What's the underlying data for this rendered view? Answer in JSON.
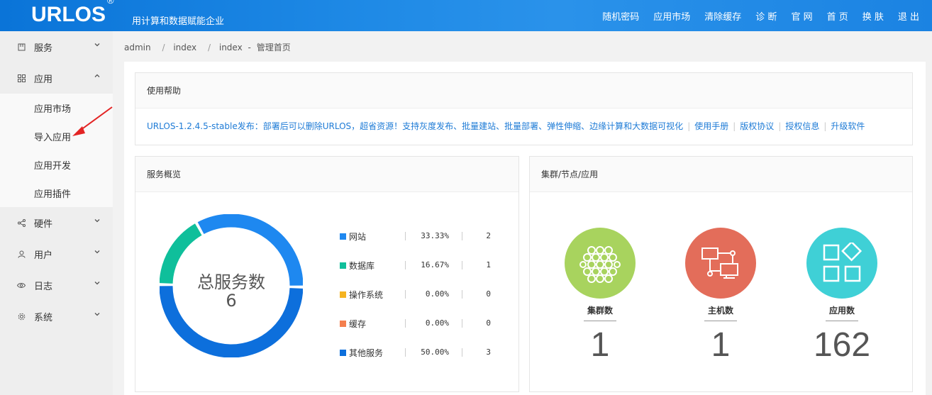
{
  "header": {
    "logo": "URLOS",
    "logo_mark": "®",
    "slogan": "用计算和数据赋能企业",
    "nav": [
      "随机密码",
      "应用市场",
      "清除缓存",
      "诊 断",
      "官 网",
      "首 页",
      "换 肤",
      "退 出"
    ]
  },
  "sidebar": {
    "items": [
      {
        "label": "服务",
        "icon": "service-icon",
        "expanded": false
      },
      {
        "label": "应用",
        "icon": "apps-grid-icon",
        "expanded": true,
        "children": [
          "应用市场",
          "导入应用",
          "应用开发",
          "应用插件"
        ]
      },
      {
        "label": "硬件",
        "icon": "share-nodes-icon",
        "expanded": false
      },
      {
        "label": "用户",
        "icon": "user-icon",
        "expanded": false
      },
      {
        "label": "日志",
        "icon": "eye-icon",
        "expanded": false
      },
      {
        "label": "系统",
        "icon": "gear-icon",
        "expanded": false
      }
    ]
  },
  "breadcrumb": [
    "admin",
    "index",
    "index",
    "-",
    "管理首页"
  ],
  "help": {
    "title": "使用帮助",
    "announcement": "URLOS-1.2.4.5-stable发布：部署后可以删除URLOS，超省资源！支持灰度发布、批量建站、批量部署、弹性伸缩、边缘计算和大数据可视化",
    "links": [
      "使用手册",
      "版权协议",
      "授权信息",
      "升级软件"
    ]
  },
  "services": {
    "title": "服务概览",
    "center_label": "总服务数",
    "total": "6",
    "rows": [
      {
        "name": "网站",
        "pct": "33.33%",
        "count": "2",
        "color": "#1e88f0"
      },
      {
        "name": "数据库",
        "pct": "16.67%",
        "count": "1",
        "color": "#0fbf9b"
      },
      {
        "name": "操作系统",
        "pct": "0.00%",
        "count": "0",
        "color": "#f5b422"
      },
      {
        "name": "缓存",
        "pct": "0.00%",
        "count": "0",
        "color": "#f47f4e"
      },
      {
        "name": "其他服务",
        "pct": "50.00%",
        "count": "3",
        "color": "#0d6fdc"
      }
    ]
  },
  "nodes": {
    "title": "集群/节点/应用",
    "stats": [
      {
        "label": "集群数",
        "value": "1",
        "color": "#a8d35e",
        "icon": "honeycomb-icon"
      },
      {
        "label": "主机数",
        "value": "1",
        "color": "#e36d5a",
        "icon": "network-hosts-icon"
      },
      {
        "label": "应用数",
        "value": "162",
        "color": "#3fd0d6",
        "icon": "apps-icon"
      }
    ]
  },
  "colors": {
    "header": "#1b83e2",
    "link": "#1e7bd6",
    "annotation_arrow": "#e32424"
  }
}
